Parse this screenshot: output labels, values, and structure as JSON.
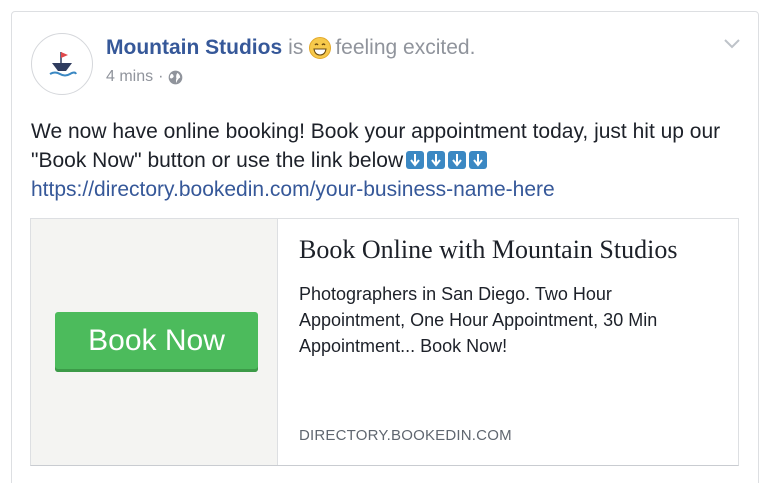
{
  "post": {
    "page_name": "Mountain Studios",
    "is_text": "is",
    "feeling_text": "feeling excited.",
    "timestamp": "4 mins",
    "separator": "·",
    "privacy_icon": "globe-icon",
    "feeling_icon": "grinning-face-icon",
    "menu_icon": "chevron-down-icon",
    "body_text": "We now have online booking! Book your appointment today, just hit up our \"Book Now\" button or use the link below",
    "arrow_emojis": [
      "down-arrow-icon",
      "down-arrow-icon",
      "down-arrow-icon",
      "down-arrow-icon"
    ],
    "link_text": "https://directory.bookedin.com/your-business-name-here"
  },
  "link_preview": {
    "button_label": "Book Now",
    "title": "Book Online with Mountain Studios",
    "description": "Photographers in San Diego. Two Hour Appointment, One Hour Appointment, 30 Min Appointment... Book Now!",
    "domain": "DIRECTORY.BOOKEDIN.COM"
  },
  "colors": {
    "page_name": "#365899",
    "muted": "#90949c",
    "button_green": "#4cbb5c",
    "arrow_blue": "#3b88c3"
  }
}
